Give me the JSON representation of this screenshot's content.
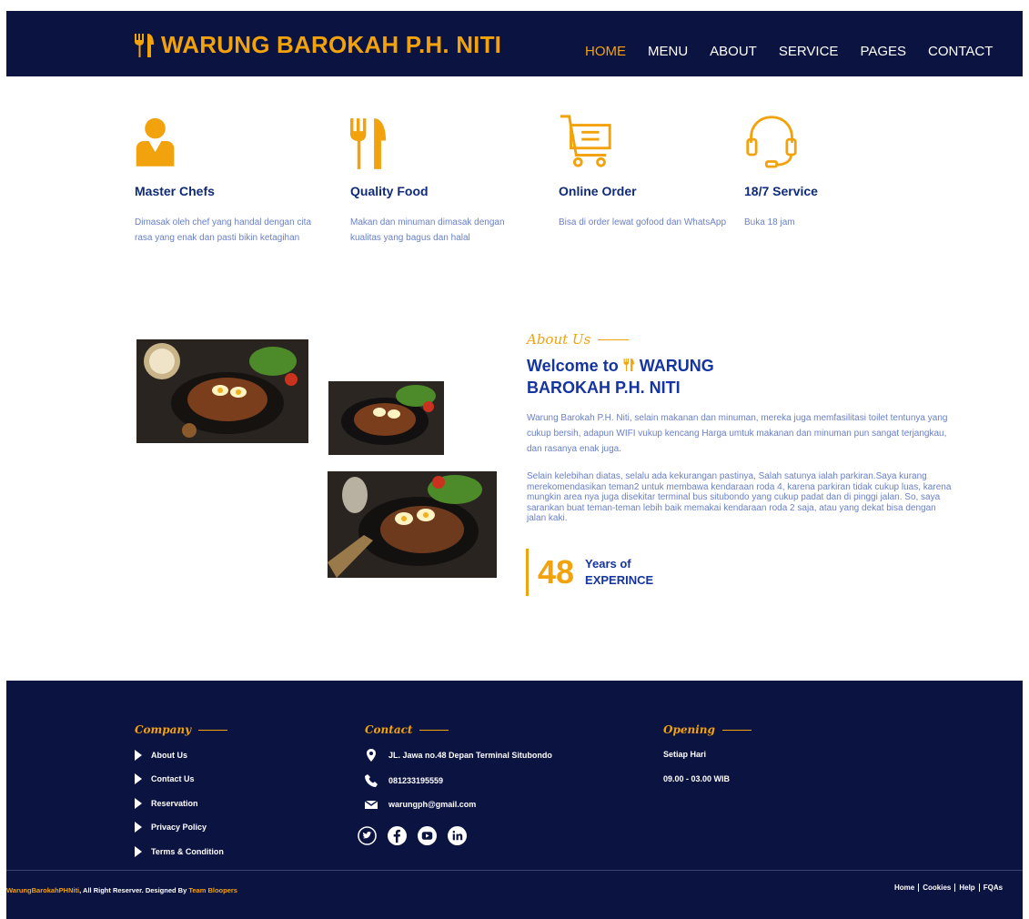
{
  "colors": {
    "navy": "#0b1340",
    "accent": "#f2a20c",
    "heading": "#1634a0",
    "body_text": "#6a80c8"
  },
  "header": {
    "brand": "WARUNG BAROKAH P.H. NITI",
    "brand_icon": "fork-knife-icon",
    "nav": [
      "HOME",
      "MENU",
      "ABOUT",
      "SERVICE",
      "PAGES",
      "CONTACT"
    ],
    "active_nav": "HOME"
  },
  "features": [
    {
      "icon": "chef-icon",
      "title": "Master Chefs",
      "desc": "Dimasak oleh chef yang handal dengan cita rasa yang enak dan pasti bikin ketagihan"
    },
    {
      "icon": "fork-knife-icon",
      "title": "Quality Food",
      "desc": "Makan dan minuman dimasak dengan kualitas yang bagus dan halal"
    },
    {
      "icon": "cart-icon",
      "title": "Online Order",
      "desc": "Bisa di order lewat gofood dan WhatsApp"
    },
    {
      "icon": "headset-icon",
      "title": "18/7 Service",
      "desc": "Buka 18 jam"
    }
  ],
  "about": {
    "tag": "About Us",
    "title_prefix": "Welcome to",
    "title_brand": "WARUNG BAROKAH P.H. NITI",
    "p1": "Warung Barokah P.H. Niti, selain makanan dan minuman, mereka juga memfasilitasi toilet tentunya yang cukup bersih, adapun WIFI vukup kencang Harga umtuk makanan dan minuman pun sangat terjangkau, dan rasanya enak juga.",
    "p2": "Selain kelebihan diatas, selalu ada kekurangan pastinya, Salah satunya ialah parkiran.Saya kurang merekomendasikan teman2 untuk membawa kendaraan roda 4, karena parkiran tidak cukup luas, karena mungkin area nya juga disekitar terminal bus situbondo yang cukup padat dan di pinggi jalan. So, saya sarankan buat teman-teman lebih baik memakai kendaraan roda 2 saja, atau yang dekat bisa dengan jalan kaki.",
    "experience_number": "48",
    "experience_line1": "Years of",
    "experience_line2": "EXPERINCE"
  },
  "footer": {
    "company_heading": "Company",
    "company_links": [
      "About Us",
      "Contact Us",
      "Reservation",
      "Privacy Policy",
      "Terms & Condition"
    ],
    "contact_heading": "Contact",
    "address": "JL. Jawa no.48 Depan Terminal Situbondo",
    "phone": "081233195559",
    "email": "warungph@gmail.com",
    "socials": [
      "twitter-icon",
      "facebook-icon",
      "youtube-icon",
      "linkedin-icon"
    ],
    "opening_heading": "Opening",
    "opening_days": "Setiap Hari",
    "opening_hours": "09.00 - 03.00 WIB",
    "copyright_brand": "WarungBarokahPHNiti",
    "copyright_mid": ", All Right Reserver. Designed By ",
    "copyright_team": "Team Bloopers",
    "bottom_links": [
      "Home",
      "Cookies",
      "Help",
      "FQAs"
    ]
  }
}
